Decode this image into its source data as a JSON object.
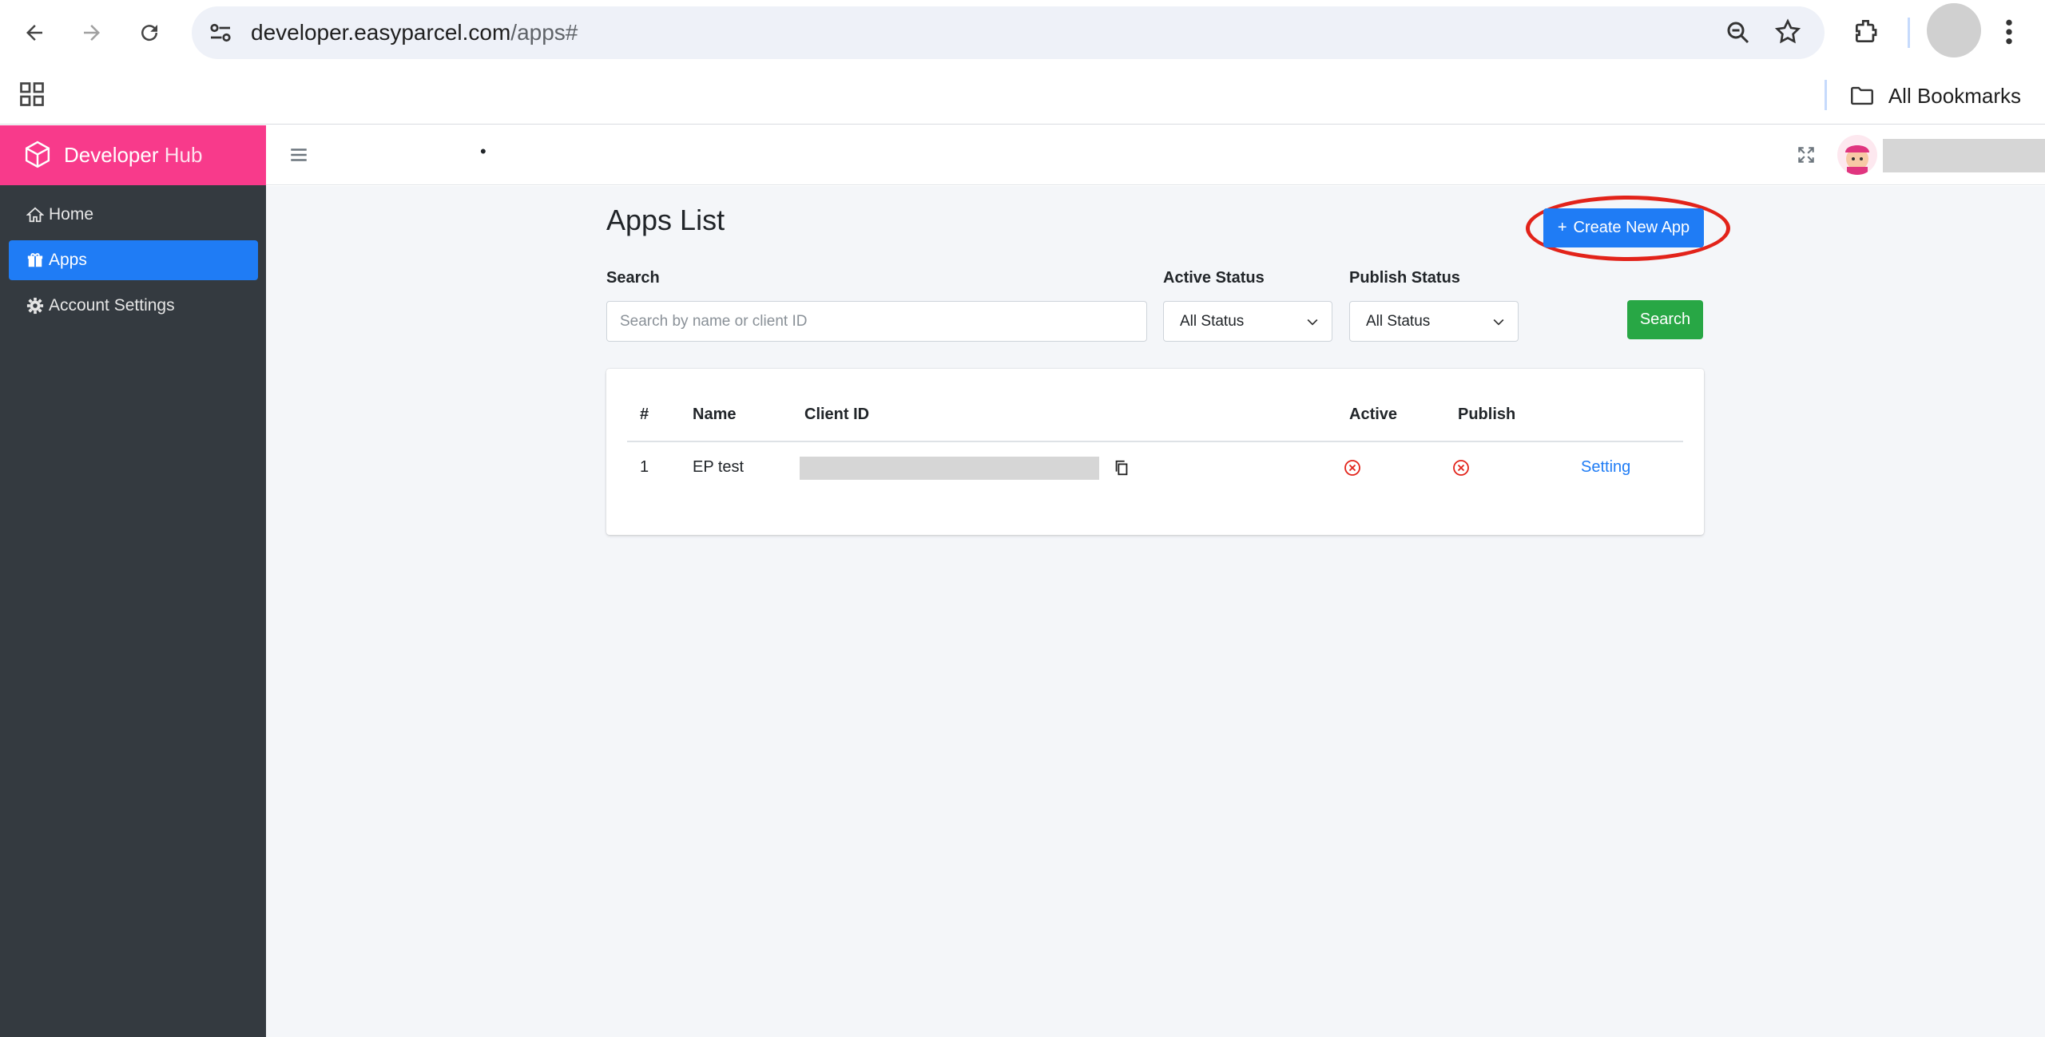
{
  "browser": {
    "url_host": "developer.easyparcel.com",
    "url_path": "/apps#",
    "bookmarks_label": "All Bookmarks"
  },
  "sidebar": {
    "brand_main": "Developer",
    "brand_sub": "Hub",
    "items": [
      {
        "label": "Home",
        "icon": "home-icon"
      },
      {
        "label": "Apps",
        "icon": "gift-icon",
        "active": true
      },
      {
        "label": "Account Settings",
        "icon": "gear-icon"
      }
    ]
  },
  "topnav": {
    "dot": "•"
  },
  "main": {
    "title": "Apps List",
    "create_button": "Create New App",
    "create_button_icon": "+",
    "search_label": "Search",
    "search_placeholder": "Search by name or client ID",
    "active_status_label": "Active Status",
    "active_status_value": "All Status",
    "publish_status_label": "Publish Status",
    "publish_status_value": "All Status",
    "search_button": "Search"
  },
  "table": {
    "headers": [
      "#",
      "Name",
      "Client ID",
      "Active",
      "Publish"
    ],
    "rows": [
      {
        "index": "1",
        "name": "EP test",
        "active": "inactive",
        "publish": "inactive",
        "action": "Setting"
      }
    ]
  },
  "colors": {
    "brand": "#f83a8b",
    "primary": "#1f7cf5",
    "success": "#28a745",
    "sidebar": "#343a40",
    "danger": "#e2231a"
  }
}
